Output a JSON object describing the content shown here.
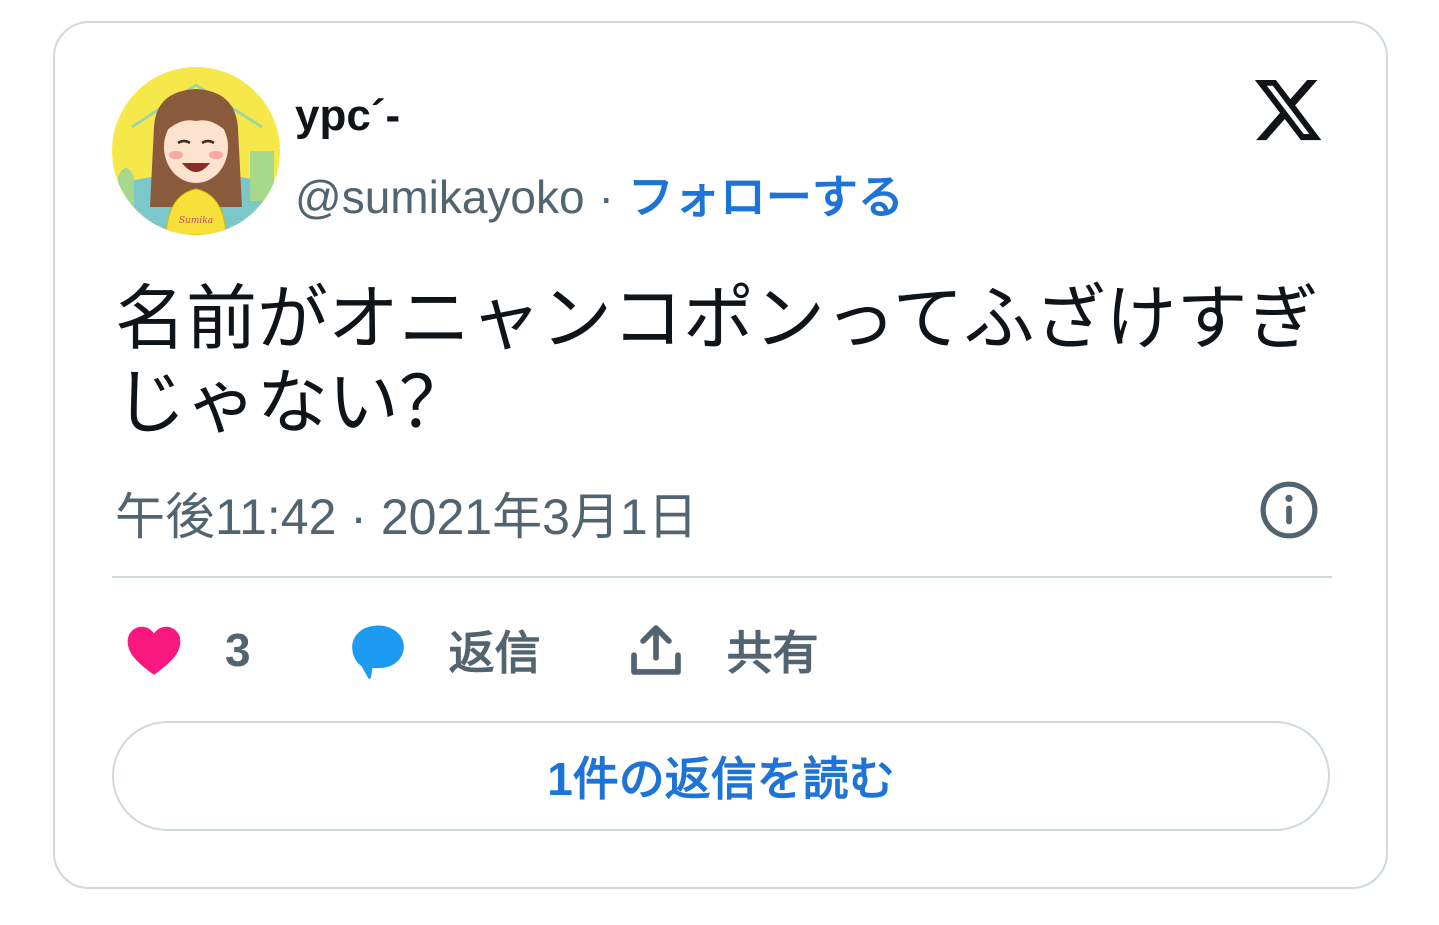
{
  "author": {
    "display_name": "ypc´-",
    "handle": "@sumikayoko",
    "separator": "·",
    "follow_label": "フォローする",
    "avatar_signature": "Sumika"
  },
  "tweet": {
    "text": "名前がオニャンコポンってふざけすぎじゃない？",
    "timestamp": "午後11:42 · 2021年3月1日"
  },
  "actions": {
    "like_count": "3",
    "reply_label": "返信",
    "share_label": "共有"
  },
  "read_replies_label": "1件の返信を読む",
  "icons": {
    "logo": "x-logo-icon",
    "info": "info-icon",
    "like": "heart-icon",
    "reply": "speech-bubble-icon",
    "share": "share-upload-icon"
  },
  "colors": {
    "link": "#1d73d6",
    "muted": "#536471",
    "heart": "#f91880",
    "reply_bubble": "#1d9bf0",
    "border": "#cfd9de",
    "avatar_bg": "#f6e84a"
  }
}
